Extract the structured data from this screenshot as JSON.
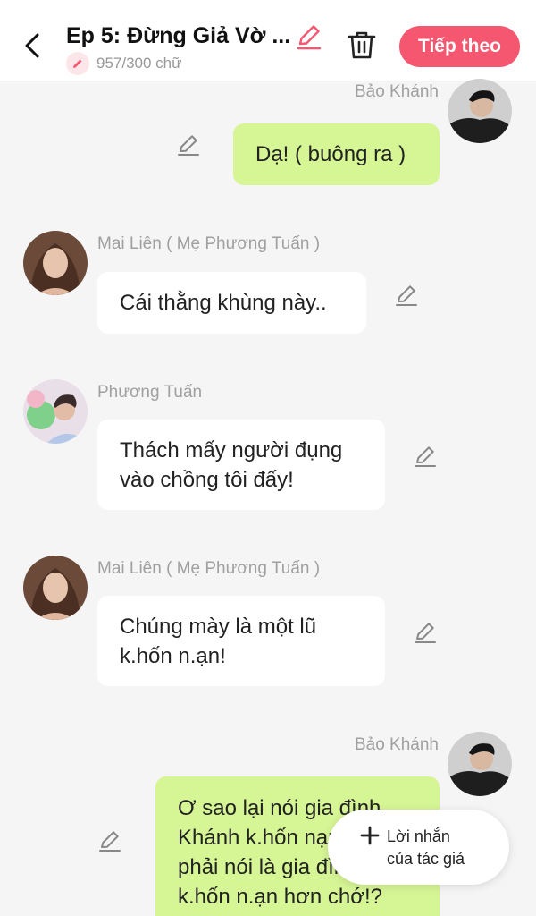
{
  "header": {
    "title": "Ep 5: Đừng Giả Vờ ...",
    "word_count": "957/300 chữ",
    "next_label": "Tiếp theo"
  },
  "messages": [
    {
      "sender": "Bảo Khánh",
      "text": "Dạ! ( buông ra )",
      "side": "right"
    },
    {
      "sender": "Mai Liên ( Mẹ Phương Tuấn )",
      "text": "Cái thằng khùng này..",
      "side": "left"
    },
    {
      "sender": "Phương Tuấn",
      "lines": [
        "Thách mấy người đụng",
        "vào chồng tôi đấy!"
      ],
      "side": "left"
    },
    {
      "sender": "Mai Liên ( Mẹ Phương Tuấn )",
      "lines": [
        "Chúng mày là một lũ",
        "k.hốn n.ạn!"
      ],
      "side": "left"
    },
    {
      "sender": "Bảo Khánh",
      "lines": [
        "Ơ sao lại nói gia đình",
        "Khánh k.hốn nạn,",
        "phải nói là gia đình",
        "k.hốn n.ạn hơn chớ!?"
      ],
      "side": "right"
    }
  ],
  "author_note": {
    "line1": "Lời nhắn",
    "line2": "của tác giả"
  },
  "colors": {
    "accent": "#f4576f",
    "my_bubble": "#d6f595",
    "other_bubble": "#ffffff",
    "background": "#f5f5f5"
  },
  "icons": [
    "back-arrow-icon",
    "pencil-icon",
    "trash-icon",
    "edit-pen-icon",
    "plus-icon"
  ]
}
